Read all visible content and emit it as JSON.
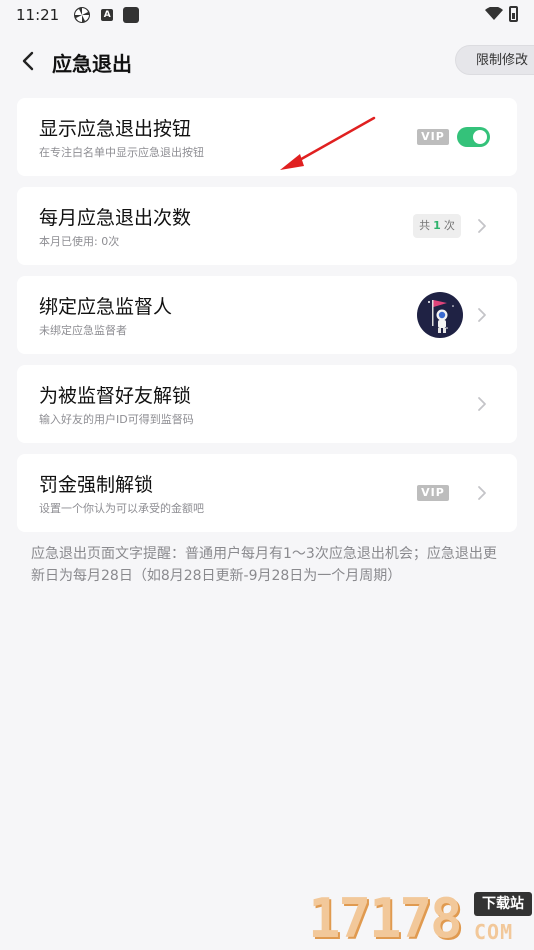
{
  "status_bar": {
    "time": "11:21"
  },
  "header": {
    "title": "应急退出",
    "limit_button": "限制修改"
  },
  "items": [
    {
      "title": "显示应急退出按钮",
      "subtitle": "在专注白名单中显示应急退出按钮",
      "vip": "VIP",
      "toggle_on": true
    },
    {
      "title": "每月应急退出次数",
      "subtitle": "本月已使用: 0次",
      "count_prefix": "共",
      "count_value": "1",
      "count_suffix": "次"
    },
    {
      "title": "绑定应急监督人",
      "subtitle": "未绑定应急监督者"
    },
    {
      "title": "为被监督好友解锁",
      "subtitle": "输入好友的用户ID可得到监督码"
    },
    {
      "title": "罚金强制解锁",
      "subtitle": "设置一个你认为可以承受的金额吧",
      "vip": "VIP"
    }
  ],
  "note": "应急退出页面文字提醒：普通用户每月有1～3次应急退出机会；应急退出更新日为每月28日（如8月28日更新-9月28日为一个月周期）",
  "watermark": {
    "number": "17178",
    "tag": "下载站",
    "domain": "COM"
  },
  "colors": {
    "toggle": "#34c27a",
    "accent_green": "#2fb36c",
    "vip_gray": "#bdbdbd",
    "annotation_arrow": "#e02020"
  }
}
